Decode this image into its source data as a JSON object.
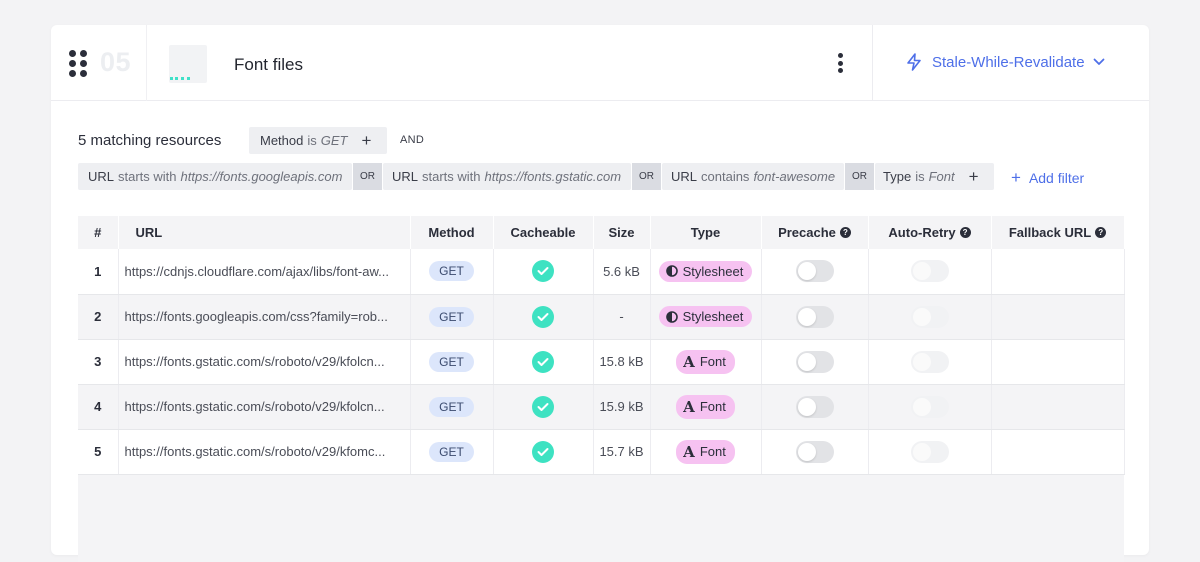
{
  "rule": {
    "order_number": "05",
    "title": "Font files",
    "strategy_label": "Stale-While-Revalidate"
  },
  "filters": {
    "matching_text": "5 matching resources",
    "method_chip": {
      "field": "Method",
      "op": "is",
      "value": "GET"
    },
    "and_label": "AND",
    "or_label": "OR",
    "url_chips": [
      {
        "field": "URL",
        "op": "starts with",
        "value": "https://fonts.googleapis.com"
      },
      {
        "field": "URL",
        "op": "starts with",
        "value": "https://fonts.gstatic.com"
      },
      {
        "field": "URL",
        "op": "contains",
        "value": "font-awesome"
      }
    ],
    "type_chip": {
      "field": "Type",
      "op": "is",
      "value": "Font"
    },
    "add_filter_label": "Add filter"
  },
  "table": {
    "headers": {
      "num": "#",
      "url": "URL",
      "method": "Method",
      "cacheable": "Cacheable",
      "size": "Size",
      "type": "Type",
      "precache": "Precache",
      "auto_retry": "Auto-Retry",
      "fallback_url": "Fallback URL"
    },
    "rows": [
      {
        "num": "1",
        "url": "https://cdnjs.cloudflare.com/ajax/libs/font-aw...",
        "method": "GET",
        "size": "5.6 kB",
        "type": "Stylesheet",
        "type_icon": "half-circle-icon"
      },
      {
        "num": "2",
        "url": "https://fonts.googleapis.com/css?family=rob...",
        "method": "GET",
        "size": "-",
        "type": "Stylesheet",
        "type_icon": "half-circle-icon"
      },
      {
        "num": "3",
        "url": "https://fonts.gstatic.com/s/roboto/v29/kfolcn...",
        "method": "GET",
        "size": "15.8 kB",
        "type": "Font",
        "type_icon": "letter-a-icon"
      },
      {
        "num": "4",
        "url": "https://fonts.gstatic.com/s/roboto/v29/kfolcn...",
        "method": "GET",
        "size": "15.9 kB",
        "type": "Font",
        "type_icon": "letter-a-icon"
      },
      {
        "num": "5",
        "url": "https://fonts.gstatic.com/s/roboto/v29/kfomc...",
        "method": "GET",
        "size": "15.7 kB",
        "type": "Font",
        "type_icon": "letter-a-icon"
      }
    ]
  },
  "colors": {
    "accent": "#4e6fe8",
    "check": "#3ee2c2",
    "type_pill": "#f6c2f1",
    "method_pill": "#dce6fb"
  }
}
